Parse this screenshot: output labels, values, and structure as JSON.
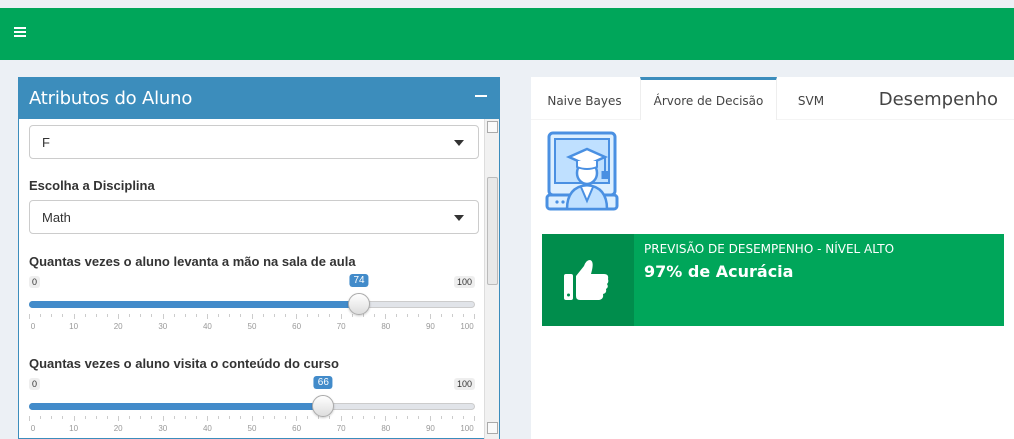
{
  "header": {
    "menu_icon": "hamburger-icon",
    "color": "#00a65a"
  },
  "left_panel": {
    "title": "Atributos do Aluno",
    "collapse_icon": "minus-icon",
    "gender_select": {
      "value": "F"
    },
    "discipline": {
      "label": "Escolha a Disciplina",
      "value": "Math"
    },
    "raised_hands": {
      "label": "Quantas vezes o aluno levanta a mão na sala de aula",
      "min": "0",
      "max": "100",
      "value": "74",
      "ticks": [
        "0",
        "10",
        "20",
        "30",
        "40",
        "50",
        "60",
        "70",
        "80",
        "90",
        "100"
      ]
    },
    "visited_resources": {
      "label": "Quantas vezes o aluno visita o conteúdo do curso",
      "min": "0",
      "max": "100",
      "value": "66",
      "ticks": [
        "0",
        "10",
        "20",
        "30",
        "40",
        "50",
        "60",
        "70",
        "80",
        "90",
        "100"
      ]
    }
  },
  "right_panel": {
    "tabs": [
      {
        "label": "Naive Bayes",
        "active": false
      },
      {
        "label": "Árvore de Decisão",
        "active": true
      },
      {
        "label": "SVM",
        "active": false
      }
    ],
    "title": "Desempenho",
    "student_icon": "student-computer-icon",
    "result": {
      "icon": "thumbs-up-icon",
      "text": "PREVISÃO DE DESEMPENHO - NÍVEL ALTO",
      "value": "97% de Acurácia"
    }
  },
  "colors": {
    "accent": "#3c8dbc",
    "success": "#00a65a",
    "success_dark": "#008d4c",
    "slider": "#428bca"
  }
}
